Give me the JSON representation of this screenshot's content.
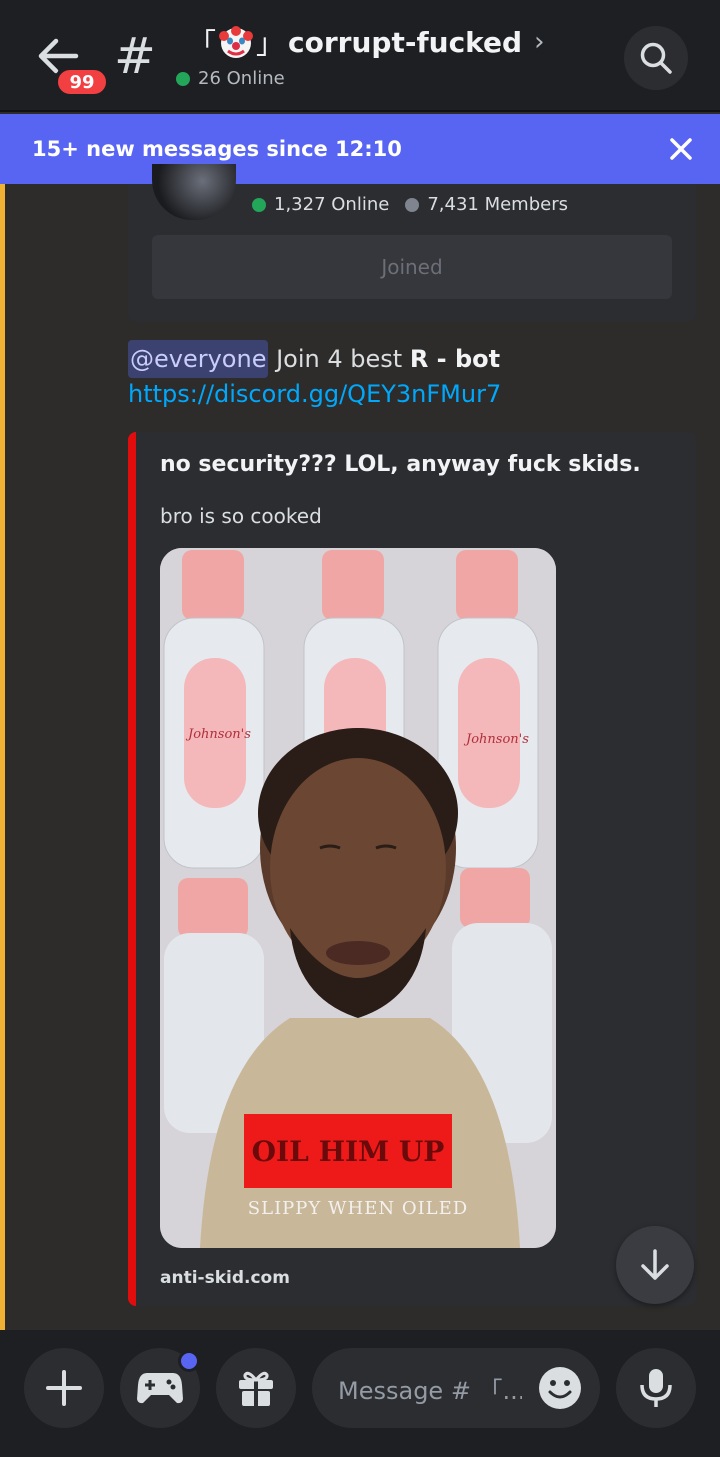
{
  "header": {
    "unread_badge": "99",
    "channel_prefix": "#",
    "channel_bracket_open": "「",
    "channel_bracket_close": "」",
    "channel_name": "corrupt-fucked",
    "online_text": "26 Online"
  },
  "new_messages_bar": {
    "text": "15+ new messages since 12:10"
  },
  "invite_card": {
    "online_count": "1,327 Online",
    "member_count": "7,431 Members",
    "button_label": "Joined"
  },
  "message": {
    "mention": "@everyone",
    "text_pre": " Join 4 best ",
    "text_bold": "R - bot",
    "link": "https://discord.gg/QEY3nFMur7"
  },
  "embed": {
    "title": "no security??? LOL, anyway fuck skids.",
    "description": "bro is so cooked",
    "image_caption_main": "OIL HIM UP",
    "image_caption_sub": "SLIPPY WHEN OILED",
    "bottle_label": "Johnson's",
    "footer": "anti-skid.com",
    "accent_color": "#e10d0d"
  },
  "composer": {
    "placeholder": "Message # 「..."
  },
  "icons": [
    "back-arrow-icon",
    "hash-icon",
    "clown-icon",
    "chevron-right-icon",
    "search-icon",
    "close-icon",
    "arrow-down-icon",
    "plus-icon",
    "gamepad-icon",
    "gift-icon",
    "emoji-icon",
    "microphone-icon"
  ],
  "colors": {
    "blurple": "#5865f2",
    "online_green": "#23a55a",
    "badge_red": "#f23f42",
    "link_blue": "#00a8fc"
  }
}
